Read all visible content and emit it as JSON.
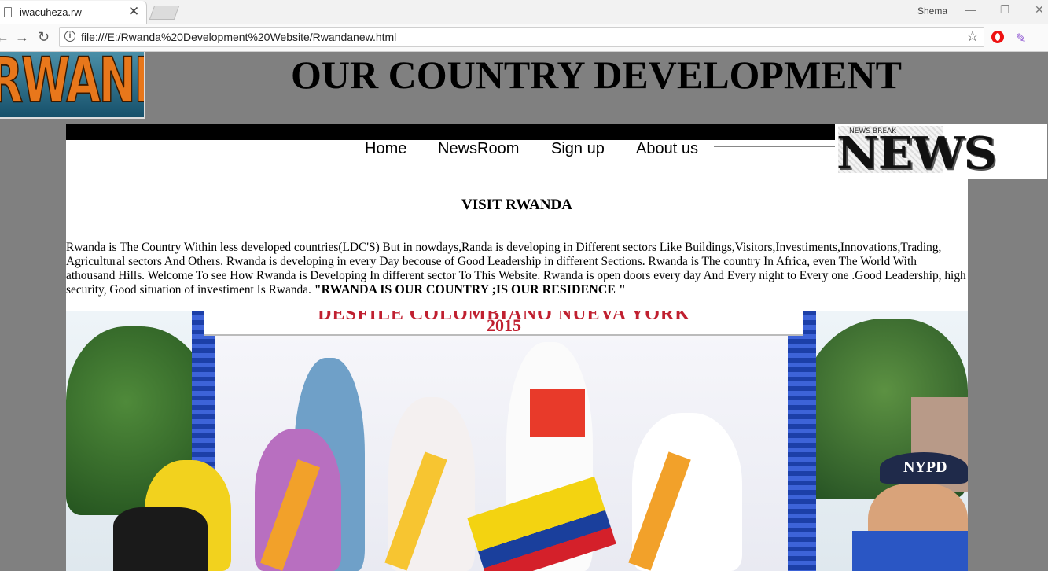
{
  "browser": {
    "tab_title": "iwacuheza.rw",
    "tab_close": "✕",
    "user_name": "Shema",
    "url": "file:///E:/Rwanda%20Development%20Website/Rwandanew.html",
    "back_icon": "←",
    "forward_icon": "→",
    "reload_icon": "↻",
    "star_icon": "☆",
    "menu_icon": "⋮",
    "minimize_icon": "—",
    "restore_icon": "❐",
    "close_icon": "✕"
  },
  "header": {
    "logo_text": "RWANDA",
    "site_title": "OUR COUNTRY DEVELOPMENT"
  },
  "nav": {
    "items": [
      {
        "label": "Home"
      },
      {
        "label": "NewsRoom"
      },
      {
        "label": "Sign up"
      },
      {
        "label": "About us"
      }
    ]
  },
  "news_image": {
    "word": "NEWS",
    "tiny": "NEWS   BREAK"
  },
  "main": {
    "heading": "VISIT RWANDA",
    "paragraph": "Rwanda is The Country Within less developed countries(LDC'S) But in nowdays,Randa is developing in Different sectors Like Buildings,Visitors,Investiments,Innovations,Trading, Agricultural sectors And Others. Rwanda is developing in every Day becouse of Good Leadership in different Sections. Rwanda is The country In Africa, even The World With athousand Hills. Welcome To see How Rwanda is Developing In different sector To This Website. Rwanda is open doors every day And Every night to Every one .Good Leadership, high security, Good situation of investiment Is Rwanda. ",
    "paragraph_bold": "\"RWANDA IS OUR COUNTRY ;IS OUR RESIDENCE \""
  },
  "photo": {
    "banner_line1": "DESFILE COLOMBIANO NUEVA YORK",
    "banner_line2": "2015",
    "cap_text": "NYPD"
  },
  "colors": {
    "page_bg": "#808080",
    "content_bg": "#ffffff",
    "logo_orange": "#e8771b"
  }
}
